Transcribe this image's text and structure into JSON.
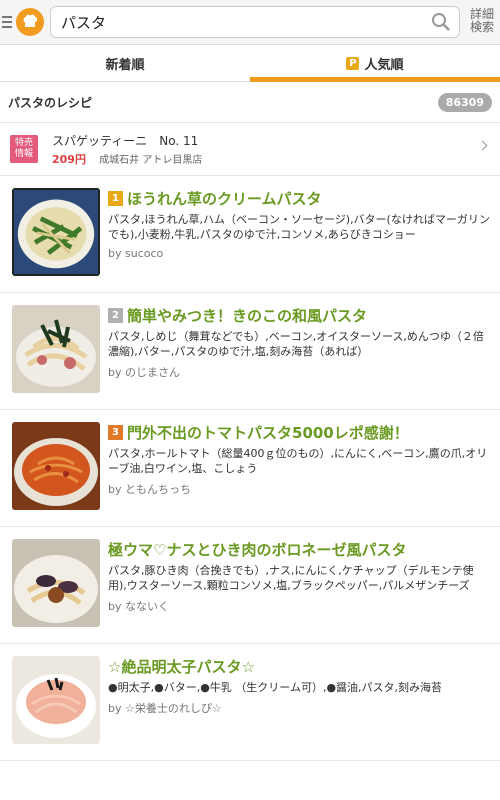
{
  "search": {
    "value": "パスタ",
    "advanced_label_line1": "詳細",
    "advanced_label_line2": "検索"
  },
  "tabs": [
    {
      "label": "新着順",
      "active": false
    },
    {
      "label": "人気順",
      "active": true,
      "icon": "premium-p-icon"
    }
  ],
  "results": {
    "title": "パスタのレシピ",
    "count": "86309"
  },
  "promo": {
    "badge_line1": "特売",
    "badge_line2": "情報",
    "name": "スパゲッティーニ　No. 11",
    "price": "209円",
    "store": "成城石井 アトレ目黒店"
  },
  "recipes": [
    {
      "rank": "1",
      "title": "ほうれん草のクリームパスタ",
      "ingredients": "パスタ,ほうれん草,ハム（ベーコン・ソーセージ),バター(なければマーガリンでも),小麦粉,牛乳,パスタのゆで汁,コンソメ,あらびきコショー",
      "author": "by sucoco"
    },
    {
      "rank": "2",
      "title": "簡単やみつき！きのこの和風パスタ",
      "ingredients": "パスタ,しめじ（舞茸などでも）,ベーコン,オイスターソース,めんつゆ（２倍濃縮),バター,パスタのゆで汁,塩,刻み海苔（あれば）",
      "author": "by のじまさん"
    },
    {
      "rank": "3",
      "title": "門外不出のトマトパスタ5000レポ感謝！",
      "ingredients": "パスタ,ホールトマト（総量400ｇ位のもの）,にんにく,ベーコン,鷹の爪,オリーブ油,白ワイン,塩、こしょう",
      "author": "by ともんちっち"
    },
    {
      "rank": "",
      "title": "極ウマ♡ナスとひき肉のボロネーゼ風パスタ",
      "ingredients": "パスタ,豚ひき肉（合挽きでも）,ナス,にんにく,ケチャップ（デルモンテ使用),ウスターソース,顆粒コンソメ,塩,ブラックペッパー,パルメザンチーズ",
      "author": "by なないく"
    },
    {
      "rank": "",
      "title": "☆絶品明太子パスタ☆",
      "ingredients": "●明太子,●バター,●牛乳 （生クリーム可）,●醤油,パスタ,刻み海苔",
      "author": "by ☆栄養士のれしぴ☆"
    }
  ]
}
